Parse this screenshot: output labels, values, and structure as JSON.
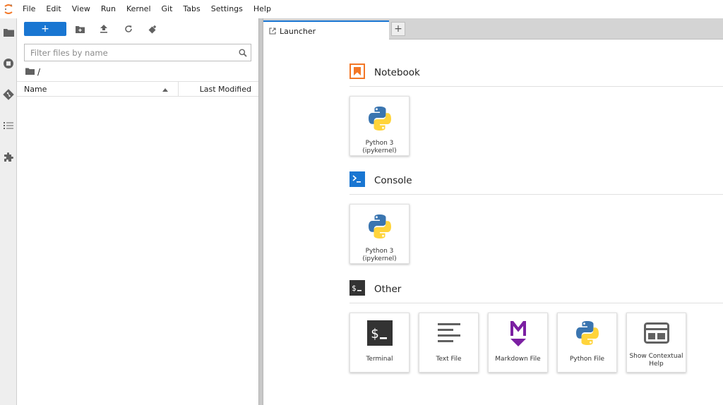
{
  "menubar": {
    "items": [
      "File",
      "Edit",
      "View",
      "Run",
      "Kernel",
      "Git",
      "Tabs",
      "Settings",
      "Help"
    ]
  },
  "activity": {
    "icons": [
      "folder-icon",
      "running-icon",
      "git-icon",
      "toc-icon",
      "extension-icon"
    ]
  },
  "filebrowser": {
    "new_label": "+",
    "filter_placeholder": "Filter files by name",
    "breadcrumb": "/",
    "col_name": "Name",
    "col_modified": "Last Modified"
  },
  "tabs": {
    "active_label": "Launcher",
    "add_label": "+"
  },
  "launcher": {
    "notebook": {
      "title": "Notebook",
      "cards": [
        {
          "line1": "Python 3",
          "line2": "(ipykernel)"
        }
      ]
    },
    "console": {
      "title": "Console",
      "cards": [
        {
          "line1": "Python 3",
          "line2": "(ipykernel)"
        }
      ]
    },
    "other": {
      "title": "Other",
      "cards": [
        {
          "line1": "Terminal",
          "line2": ""
        },
        {
          "line1": "Text File",
          "line2": ""
        },
        {
          "line1": "Markdown File",
          "line2": ""
        },
        {
          "line1": "Python File",
          "line2": ""
        },
        {
          "line1": "Show Contextual",
          "line2": "Help"
        }
      ]
    }
  },
  "colors": {
    "accent": "#1976d2",
    "notebook_orange": "#f37726",
    "markdown_purple": "#7b1fa2",
    "python_blue": "#3a75b0",
    "python_yellow": "#ffd43b"
  }
}
